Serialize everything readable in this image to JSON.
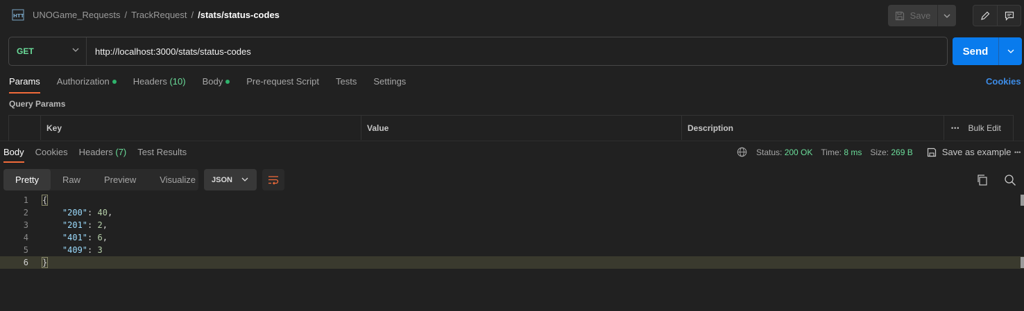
{
  "topbar": {
    "breadcrumb": [
      "UNOGame_Requests",
      "TrackRequest",
      "/stats/status-codes"
    ],
    "breadcrumb_sep": "/",
    "save_label": "Save",
    "icons": [
      "http-icon",
      "save-icon",
      "chevron-down-icon",
      "pencil-icon",
      "comment-icon"
    ]
  },
  "request": {
    "method": "GET",
    "url": "http://localhost:3000/stats/status-codes",
    "send_label": "Send"
  },
  "request_tabs": [
    {
      "label": "Params",
      "active": true
    },
    {
      "label": "Authorization",
      "dot": true
    },
    {
      "label": "Headers",
      "count": "(10)"
    },
    {
      "label": "Body",
      "dot": true
    },
    {
      "label": "Pre-request Script"
    },
    {
      "label": "Tests"
    },
    {
      "label": "Settings"
    }
  ],
  "cookies_label": "Cookies",
  "query_params": {
    "title": "Query Params",
    "columns": [
      "Key",
      "Value",
      "Description"
    ],
    "bulk_edit_label": "Bulk Edit",
    "more_label": "•••"
  },
  "response_tabs": [
    {
      "label": "Body",
      "active": true
    },
    {
      "label": "Cookies"
    },
    {
      "label": "Headers",
      "count": "(7)"
    },
    {
      "label": "Test Results"
    }
  ],
  "response_meta": {
    "status_label": "Status:",
    "status_value": "200 OK",
    "time_label": "Time:",
    "time_value": "8 ms",
    "size_label": "Size:",
    "size_value": "269 B",
    "save_example_label": "Save as example",
    "more_label": "•••"
  },
  "format": {
    "options": [
      "Pretty",
      "Raw",
      "Preview",
      "Visualize"
    ],
    "active": "Pretty",
    "language": "JSON"
  },
  "code_lines": [
    {
      "n": "1",
      "text": "{"
    },
    {
      "n": "2",
      "key": "\"200\"",
      "value": "40",
      "comma": true
    },
    {
      "n": "3",
      "key": "\"201\"",
      "value": "2",
      "comma": true
    },
    {
      "n": "4",
      "key": "\"401\"",
      "value": "6",
      "comma": true
    },
    {
      "n": "5",
      "key": "\"409\"",
      "value": "3",
      "comma": false
    },
    {
      "n": "6",
      "text": "}"
    }
  ],
  "colors": {
    "accent_orange": "#f26b3a",
    "send_blue": "#097bed",
    "method_green": "#6bdd9a",
    "link_blue": "#3d8de8"
  }
}
